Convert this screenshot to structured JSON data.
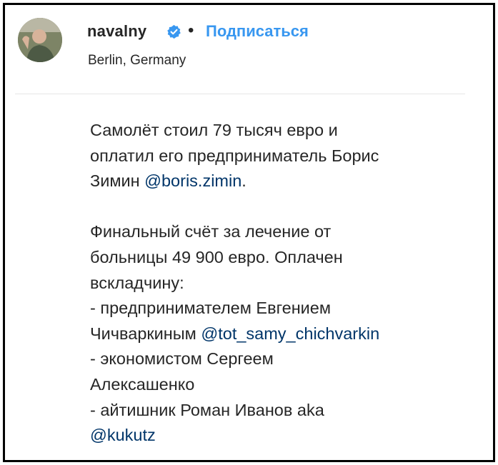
{
  "post": {
    "username": "navalny",
    "separator": "•",
    "follow_label": "Подписаться",
    "location": "Berlin, Germany",
    "icons": {
      "verified": "verified-badge-icon",
      "avatar": "avatar"
    },
    "colors": {
      "follow": "#3897f0",
      "mention": "#003569",
      "verified": "#3897f0",
      "text": "#262626"
    }
  },
  "caption": {
    "p1_l1": "Самолёт стоил 79 тысяч евро и",
    "p1_l2": "оплатил его предприниматель Борис",
    "p1_l3_text": "Зимин ",
    "p1_l3_mention": "@boris.zimin",
    "p1_l3_end": ".",
    "p2_l1": "Финальный счёт за лечение от",
    "p2_l2": "больницы 49 900 евро. Оплачен",
    "p2_l3": "вскладчину:",
    "p2_l4": "- предпринимателем Евгением",
    "p2_l5_text": "Чичваркиным ",
    "p2_l5_mention": "@tot_samy_chichvarkin",
    "p2_l6": "- экономистом Сергеем",
    "p2_l7": "Алексашенко",
    "p2_l8": "- айтишник Роман Иванов aka",
    "p2_l9_mention": "@kukutz"
  }
}
